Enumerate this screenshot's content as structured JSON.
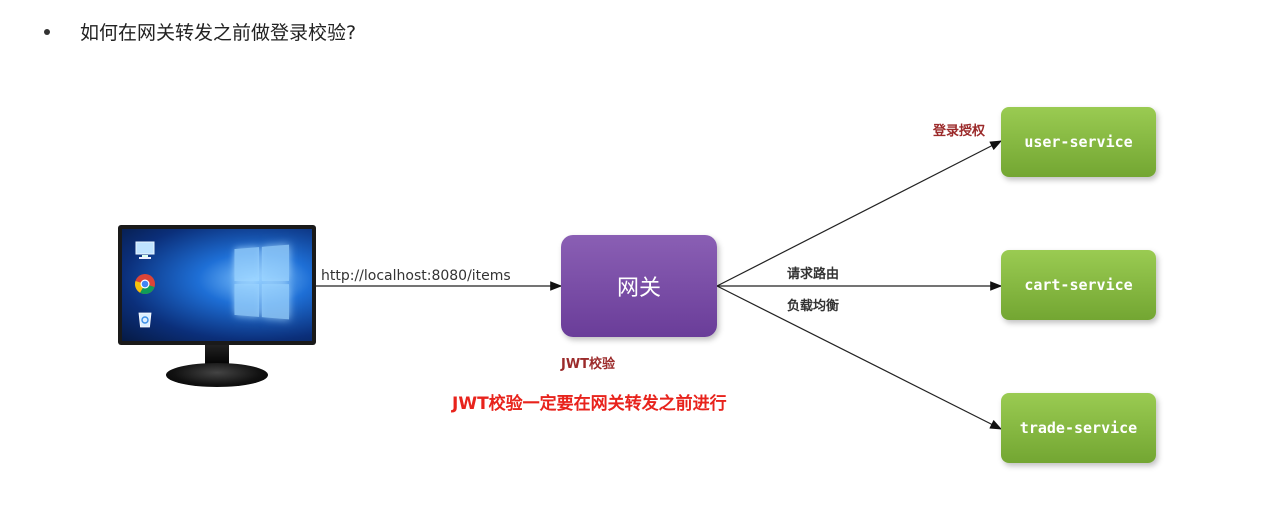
{
  "heading": {
    "text": "如何在网关转发之前做登录校验?"
  },
  "client": {
    "request_url": "http://localhost:8080/items",
    "icons": [
      "computer-icon",
      "chrome-icon",
      "recycle-bin-icon",
      "windows-logo-icon"
    ]
  },
  "gateway": {
    "label": "网关",
    "jwt_label": "JWT校验"
  },
  "routing_labels": {
    "route": "请求路由",
    "balance": "负载均衡"
  },
  "auth_label": "登录授权",
  "services": [
    {
      "label": "user-service"
    },
    {
      "label": "cart-service"
    },
    {
      "label": "trade-service"
    }
  ],
  "note": "JWT校验一定要在网关转发之前进行",
  "colors": {
    "gateway": "#7a4ba8",
    "service": "#86b843",
    "accent_red": "#e8231c",
    "dark_red": "#9b2a2a"
  }
}
